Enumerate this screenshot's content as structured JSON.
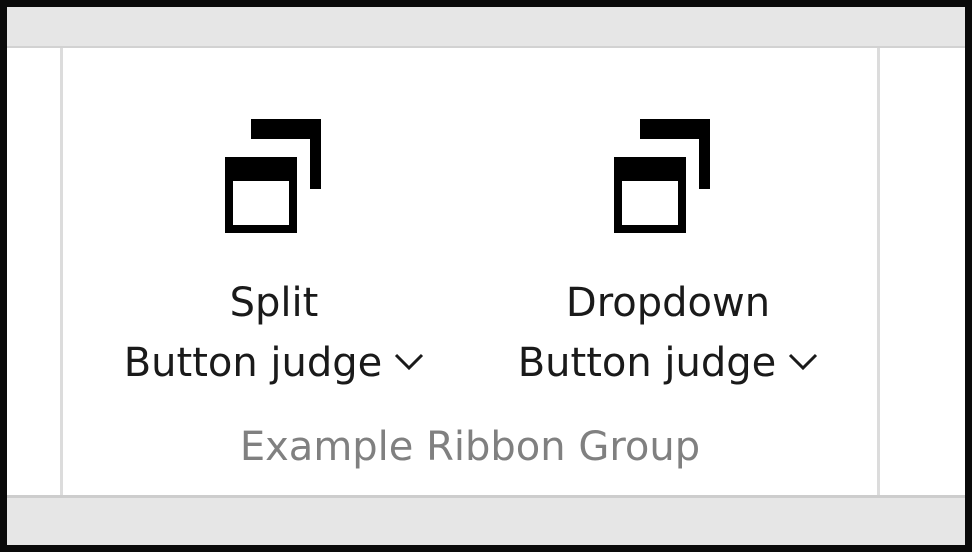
{
  "ribbon": {
    "group_label": "Example Ribbon Group",
    "buttons": [
      {
        "line1": "Split",
        "line2": "Button judge",
        "icon": "window-restore-icon"
      },
      {
        "line1": "Dropdown",
        "line2": "Button judge",
        "icon": "window-restore-icon"
      }
    ]
  }
}
